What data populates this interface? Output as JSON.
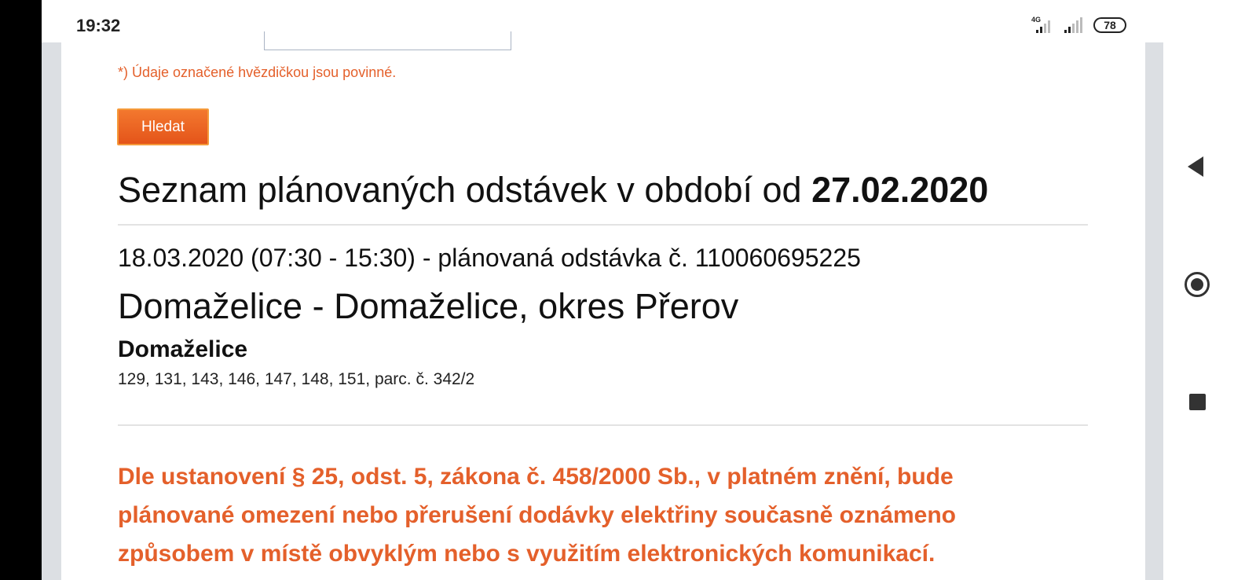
{
  "status_bar": {
    "time": "19:32",
    "network": "4G",
    "battery": "78"
  },
  "form": {
    "required_note": "*) Údaje označené hvězdičkou jsou povinné.",
    "search_button": "Hledat"
  },
  "listing": {
    "title_prefix": "Seznam plánovaných odstávek v období od",
    "title_date": "27.02.2020",
    "outage": {
      "line": "18.03.2020 (07:30 - 15:30) - plánovaná odstávka č. 110060695225",
      "area": "Domaželice - Domaželice, okres Přerov",
      "village": "Domaželice",
      "houses": "129, 131, 143, 146, 147, 148, 151, parc. č. 342/2"
    },
    "legal_note": "Dle ustanovení § 25, odst. 5, zákona č. 458/2000 Sb., v platném znění, bude plánované omezení nebo přerušení dodávky elektřiny současně oznámeno způsobem v místě obvyklým nebo s využitím elektronických komunikací."
  },
  "colors": {
    "accent": "#e4602b",
    "button": "#ef6a24"
  },
  "navigation": {
    "icons": [
      "back-icon",
      "home-icon",
      "recents-icon"
    ]
  }
}
